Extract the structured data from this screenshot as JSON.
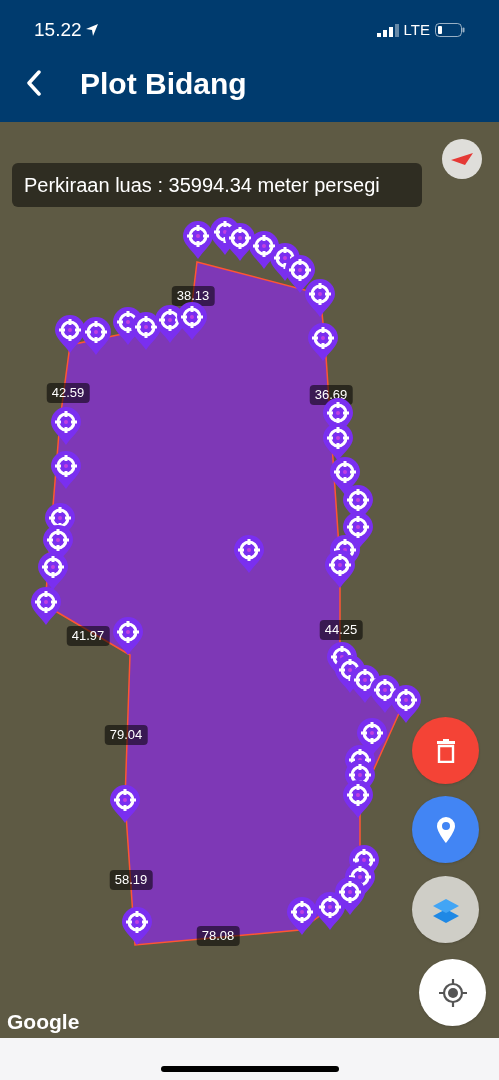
{
  "status_bar": {
    "time": "15.22",
    "network": "LTE"
  },
  "header": {
    "title": "Plot Bidang"
  },
  "area_info": "Perkiraan luas : 35994.34 meter persegi",
  "edge_labels": [
    "38.13",
    "42.59",
    "36.69",
    "41.97",
    "44.25",
    "79.04",
    "58.19",
    "78.08"
  ],
  "map": {
    "attribution": "Google"
  }
}
